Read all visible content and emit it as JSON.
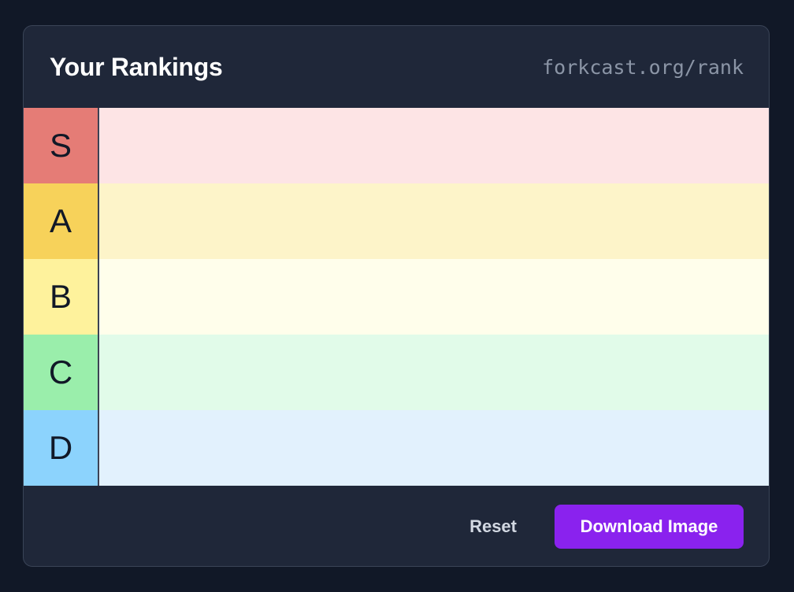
{
  "header": {
    "title": "Your Rankings",
    "url": "forkcast.org/rank"
  },
  "tiers": [
    {
      "label": "S",
      "label_color": "#e57c76",
      "row_color": "#fde4e5"
    },
    {
      "label": "A",
      "label_color": "#f7d25a",
      "row_color": "#fdf4c9"
    },
    {
      "label": "B",
      "label_color": "#fef29c",
      "row_color": "#fffeeb"
    },
    {
      "label": "C",
      "label_color": "#9aeeab",
      "row_color": "#e1fbe9"
    },
    {
      "label": "D",
      "label_color": "#8cd3fd",
      "row_color": "#e2f1fd"
    }
  ],
  "footer": {
    "reset_label": "Reset",
    "download_label": "Download Image"
  },
  "colors": {
    "page_bg": "#111827",
    "card_bg": "#1f2739",
    "accent": "#8a22ee"
  }
}
